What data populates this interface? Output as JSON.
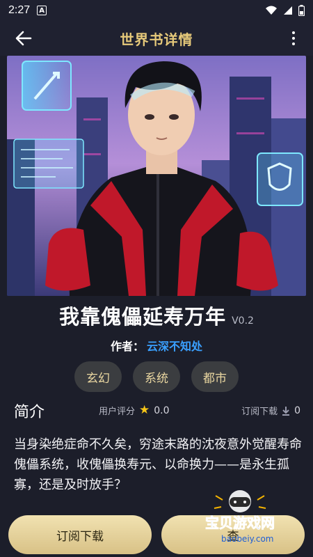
{
  "status_bar": {
    "time": "2:27",
    "notification_icon": "A"
  },
  "app_bar": {
    "title": "世界书详情",
    "back_icon": "arrow-left-icon",
    "menu_icon": "more-vert-icon"
  },
  "book": {
    "title": "我靠傀儡延寿万年",
    "version": "V0.2",
    "author_label": "作者：",
    "author": "云深不知处",
    "tags": [
      "玄幻",
      "系统",
      "都市"
    ]
  },
  "intro": {
    "heading": "简介",
    "rating_label": "用户评分",
    "rating_value": "0.0",
    "downloads_label": "订阅下载",
    "downloads_value": "0",
    "summary": "当身染绝症命不久矣，穷途末路的沈夜意外觉醒寿命傀儡系统，收傀儡换寿元、以命换力——是永生孤寡，还是及时放手？"
  },
  "actions": {
    "subscribe_label": "订阅下载",
    "second_label": "查"
  },
  "watermark": {
    "text": "宝贝游戏网",
    "url": "baobeiy.com"
  },
  "colors": {
    "accent_gold": "#e6c97a",
    "link_blue": "#3aa0ff",
    "background": "#1c1e2a"
  }
}
